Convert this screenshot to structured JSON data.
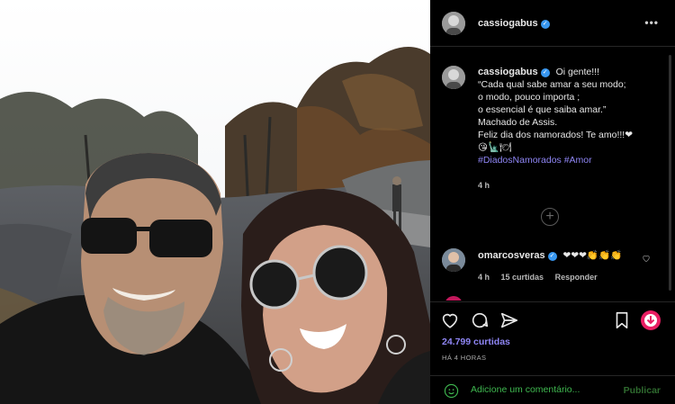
{
  "post": {
    "username": "cassiogabus",
    "verified": true
  },
  "caption": {
    "username": "cassiogabus",
    "lines": [
      "Oi gente!!!",
      "“Cada qual sabe amar a seu modo;",
      "o modo, pouco importa ;",
      "o essencial é que saiba amar.”",
      "Machado de Assis.",
      "Feliz dia dos namorados! Te amo!!!❤",
      "😘🗽🍽"
    ],
    "hashtags": "#DiadosNamorados #Amor",
    "time": "4 h"
  },
  "comment": {
    "username": "omarcosveras",
    "text": "❤❤❤👏👏👏",
    "time": "4 h",
    "likes": "15 curtidas",
    "reply": "Responder"
  },
  "actions": {
    "likes": "24.799 curtidas",
    "posted": "HÁ 4 HORAS"
  },
  "comment_box": {
    "placeholder": "Adicione um comentário...",
    "publish": "Publicar"
  },
  "icons": {
    "more": "more-options-icon",
    "like": "heart-icon",
    "comment": "comment-icon",
    "share": "share-icon",
    "save": "bookmark-icon",
    "download": "download-icon",
    "emoji": "emoji-icon",
    "load_more": "plus-circle-icon"
  },
  "colors": {
    "panel_bg": "#000000",
    "link": "#8f86f5",
    "verified": "#3897f0",
    "placeholder": "#3fb850"
  }
}
